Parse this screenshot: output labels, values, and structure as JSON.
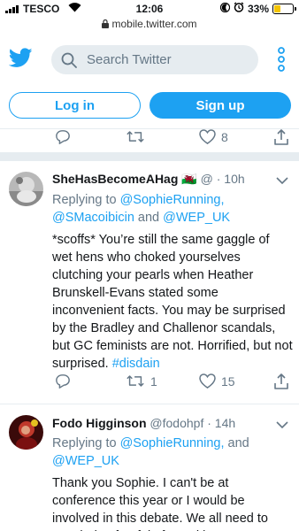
{
  "status_bar": {
    "carrier": "TESCO",
    "time": "12:06",
    "battery_percent": "33%",
    "battery_level": 0.33
  },
  "browser": {
    "url": "mobile.twitter.com"
  },
  "header": {
    "search_placeholder": "Search Twitter"
  },
  "auth": {
    "login_label": "Log in",
    "signup_label": "Sign up"
  },
  "colors": {
    "twitter_blue": "#1da1f2",
    "text_gray": "#657786",
    "battery_yellow": "#f5c400"
  },
  "prev_tweet_actions": {
    "reply_count": "",
    "retweet_count": "",
    "like_count": "8"
  },
  "tweets": [
    {
      "display_name": "SheHasBecomeAHag",
      "flag": "🏴󠁧󠁢󠁷󠁬󠁳󠁿",
      "handle": "@",
      "separator": "·",
      "time": "10h",
      "replying_prefix": "Replying to ",
      "reply_line1_link": "@SophieRunning,",
      "reply_line2_link_a": "@SMacoibicin",
      "reply_line2_and": " and ",
      "reply_line2_link_b": "@WEP_UK",
      "text": "*scoffs* You’re still the same gaggle of wet hens who choked yourselves clutching your pearls when Heather Brunskell-Evans stated some inconvenient facts. You may be surprised by the Bradley and Challenor scandals, but GC feminists are not. Horrified, but not surprised. ",
      "hashtag": "#disdain",
      "reply_count": "",
      "retweet_count": "1",
      "like_count": "15"
    },
    {
      "display_name": "Fodo Higginson",
      "handle": "@fodohpf",
      "separator": "·",
      "time": "14h",
      "replying_prefix": "Replying to ",
      "reply_line1_link": "@SophieRunning,",
      "reply_line1_and": " and",
      "reply_line2_link_a": "@WEP_UK",
      "text": "Thank you Sophie. I can't be at conference this year or I would be involved in this debate. We all need to stop being fearful of speaking"
    }
  ]
}
